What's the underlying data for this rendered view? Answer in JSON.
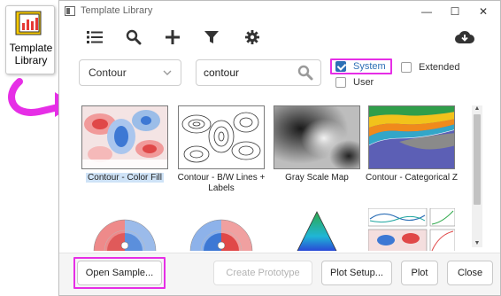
{
  "desktop": {
    "shortcut_label": "Template\nLibrary",
    "shortcut_icon": "template-library-icon",
    "callout_color": "#e62ee6"
  },
  "window": {
    "title": "Template Library",
    "controls": {
      "minimize": "—",
      "maximize": "☐",
      "close": "✕"
    }
  },
  "toolbar": {
    "icons": [
      "list-icon",
      "search-icon",
      "add-icon",
      "filter-icon",
      "settings-icon",
      "cloud-download-icon"
    ]
  },
  "filters": {
    "category": {
      "selected": "Contour"
    },
    "search": {
      "value": "contour"
    },
    "system": {
      "label": "System",
      "checked": true
    },
    "user": {
      "label": "User",
      "checked": false
    },
    "extended": {
      "label": "Extended",
      "checked": false
    }
  },
  "templates": [
    {
      "caption": "Contour - Color Fill",
      "selected": true
    },
    {
      "caption": "Contour - B/W Lines + Labels",
      "selected": false
    },
    {
      "caption": "Gray Scale Map",
      "selected": false
    },
    {
      "caption": "Contour - Categorical Z",
      "selected": false
    }
  ],
  "footer": {
    "open_sample": "Open Sample...",
    "create_prototype": "Create Prototype",
    "plot_setup": "Plot Setup...",
    "plot": "Plot",
    "close": "Close"
  },
  "colors": {
    "accent": "#2d6fb6",
    "highlight": "#e62ee6",
    "selected_caption_bg": "#cfe3f7"
  }
}
